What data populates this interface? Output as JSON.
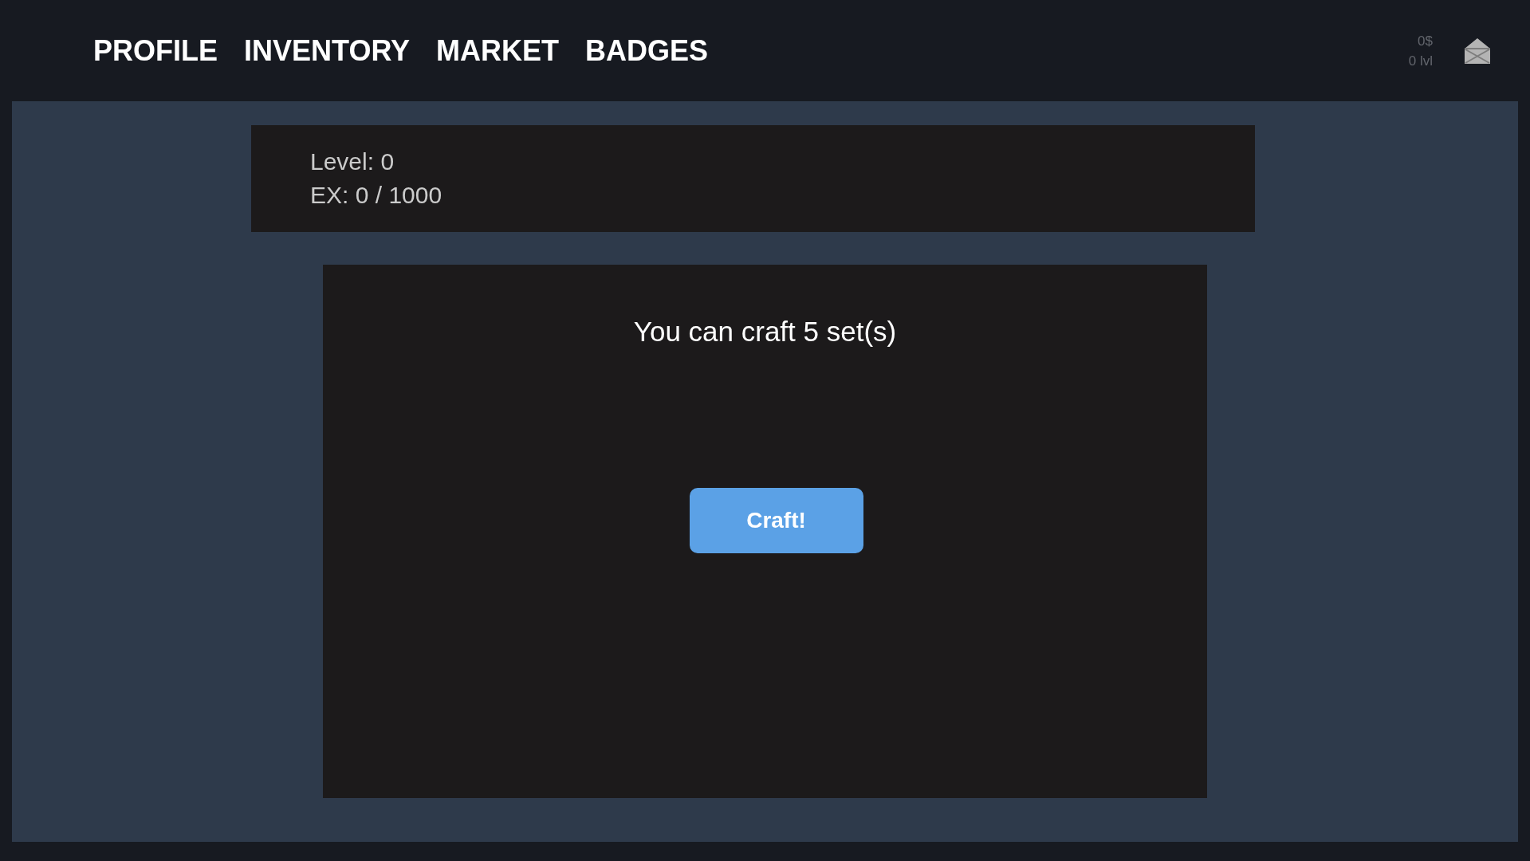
{
  "nav": {
    "items": [
      {
        "label": "PROFILE"
      },
      {
        "label": "INVENTORY"
      },
      {
        "label": "MARKET"
      },
      {
        "label": "BADGES"
      }
    ]
  },
  "user_stats": {
    "balance": "0$",
    "level": "0 lvl"
  },
  "level_panel": {
    "level": "Level: 0",
    "experience": "EX: 0 / 1000"
  },
  "craft_panel": {
    "message": "You can craft 5 set(s)",
    "button": "Craft!"
  }
}
